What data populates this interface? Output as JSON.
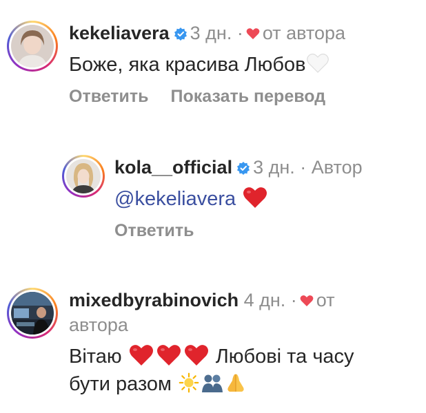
{
  "comments": [
    {
      "username": "kekeliavera",
      "verified": true,
      "time": "3 дн.",
      "separator": "·",
      "liked_label": "от автора",
      "text": "Боже, яка красива Любов",
      "actions": [
        "Ответить",
        "Показать перевод"
      ]
    },
    {
      "username": "kola__official",
      "verified": true,
      "time": "3 дн.",
      "separator": "·",
      "author_label": "Автор",
      "mention": "@kekeliavera",
      "actions": [
        "Ответить"
      ]
    },
    {
      "username": "mixedbyrabinovich",
      "verified": false,
      "time": "4 дн.",
      "separator": "·",
      "liked_label_1": "от",
      "liked_label_2": "автора",
      "text_1": "Вітаю",
      "text_2": "Любові та часу",
      "text_3": "бути разом"
    }
  ],
  "colors": {
    "heart": "#ed4956",
    "verified": "#3897f0",
    "mention": "#3b4fa0",
    "meta": "#8e8e8e"
  },
  "icons": [
    "verified-badge-icon",
    "heart-icon",
    "white-heart-emoji",
    "red-heart-emoji",
    "sun-emoji",
    "people-hugging-emoji",
    "folded-hands-emoji"
  ]
}
